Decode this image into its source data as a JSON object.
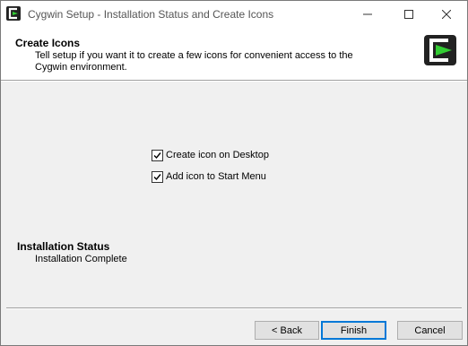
{
  "window": {
    "title": "Cygwin Setup - Installation Status and Create Icons"
  },
  "header": {
    "title": "Create Icons",
    "description": "Tell setup if you want it to create a few icons for convenient access to the Cygwin environment."
  },
  "options": {
    "desktop_icon_label": "Create icon on Desktop",
    "desktop_icon_checked": true,
    "start_menu_label": "Add icon to Start Menu",
    "start_menu_checked": true
  },
  "status": {
    "title": "Installation Status",
    "text": "Installation Complete"
  },
  "buttons": {
    "back": "< Back",
    "finish": "Finish",
    "cancel": "Cancel"
  },
  "colors": {
    "accent": "#0078d7",
    "logo_green": "#33cc33",
    "logo_dark": "#222222"
  },
  "icons": {
    "app": "cygwin-logo-icon",
    "minimize": "minimize-icon",
    "maximize": "maximize-icon",
    "close": "close-icon",
    "check": "checkmark-icon"
  }
}
